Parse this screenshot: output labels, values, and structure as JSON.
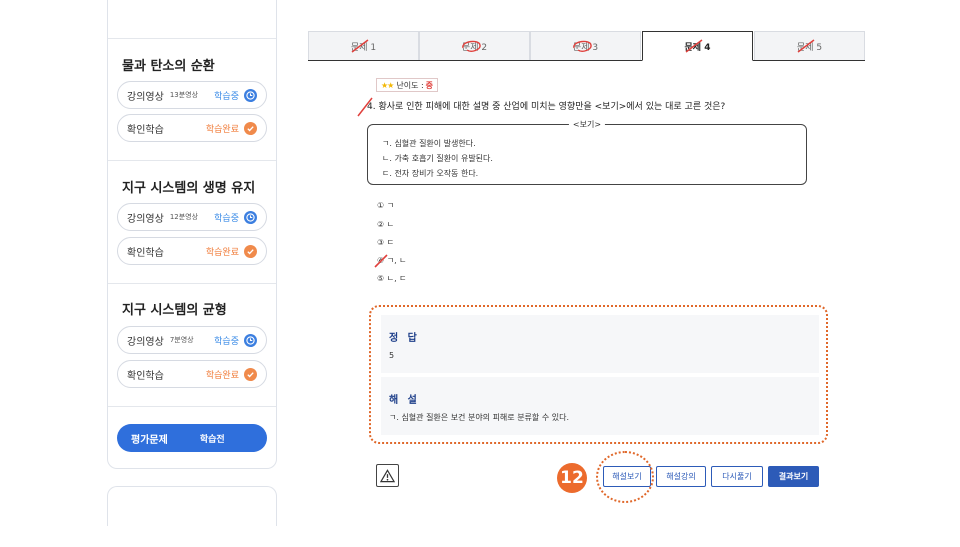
{
  "sidebar": {
    "sections": [
      {
        "title": "물과 탄소의 순환",
        "lecture": {
          "label": "강의영상",
          "duration": "13분영상",
          "status": "학습중"
        },
        "review": {
          "label": "확인학습",
          "status": "학습완료"
        }
      },
      {
        "title": "지구 시스템의 생명 유지",
        "lecture": {
          "label": "강의영상",
          "duration": "12분영상",
          "status": "학습중"
        },
        "review": {
          "label": "확인학습",
          "status": "학습완료"
        }
      },
      {
        "title": "지구 시스템의 균형",
        "lecture": {
          "label": "강의영상",
          "duration": "7분영상",
          "status": "학습중"
        },
        "review": {
          "label": "확인학습",
          "status": "학습완료"
        }
      }
    ],
    "evaluation": {
      "label": "평가문제",
      "status": "학습전"
    }
  },
  "tabs": [
    {
      "label": "문제 1",
      "mark": "wrong"
    },
    {
      "label": "문제 2",
      "mark": "correct"
    },
    {
      "label": "문제 3",
      "mark": "correct"
    },
    {
      "label": "문제 4",
      "mark": "wrong"
    },
    {
      "label": "문제 5",
      "mark": "wrong"
    }
  ],
  "question": {
    "difficulty_label": "난이도 :",
    "difficulty_value": "중",
    "text": "4. 황사로 인한 피해에 대한 설명 중 산업에 미치는 영향만을 <보기>에서 있는 대로 고른 것은?",
    "bogi_title": "<보기>",
    "bogi_items": [
      "ㄱ. 심혈관 질환이 발생한다.",
      "ㄴ. 가축 호흡기 질환이 유발된다.",
      "ㄷ. 전자 장비가 오작동 한다."
    ],
    "choices": [
      "① ㄱ",
      "② ㄴ",
      "③ ㄷ",
      "④ ㄱ, ㄴ",
      "⑤ ㄴ, ㄷ"
    ]
  },
  "answer": {
    "heading": "정 답",
    "value": "5",
    "explanation_heading": "해 설",
    "explanation": "ㄱ. 심혈관 질환은 보건 분야의 피해로 분류할 수 있다."
  },
  "buttons": {
    "badge": "12",
    "explanation": "해설보기",
    "lecture": "해설강의",
    "retry": "다시풀기",
    "result": "결과보기"
  },
  "colors": {
    "accent_blue": "#2d5bb8",
    "status_orange": "#f07b38",
    "annotation_orange": "#e0682a",
    "mark_red": "#e0403c"
  }
}
